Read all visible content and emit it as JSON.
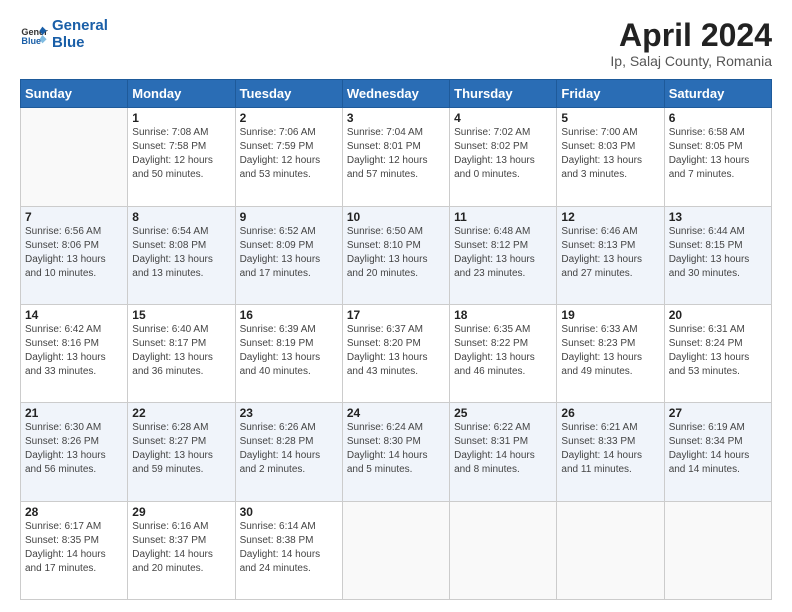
{
  "header": {
    "logo_line1": "General",
    "logo_line2": "Blue",
    "title": "April 2024",
    "subtitle": "Ip, Salaj County, Romania"
  },
  "weekdays": [
    "Sunday",
    "Monday",
    "Tuesday",
    "Wednesday",
    "Thursday",
    "Friday",
    "Saturday"
  ],
  "weeks": [
    [
      {
        "day": "",
        "info": ""
      },
      {
        "day": "1",
        "info": "Sunrise: 7:08 AM\nSunset: 7:58 PM\nDaylight: 12 hours\nand 50 minutes."
      },
      {
        "day": "2",
        "info": "Sunrise: 7:06 AM\nSunset: 7:59 PM\nDaylight: 12 hours\nand 53 minutes."
      },
      {
        "day": "3",
        "info": "Sunrise: 7:04 AM\nSunset: 8:01 PM\nDaylight: 12 hours\nand 57 minutes."
      },
      {
        "day": "4",
        "info": "Sunrise: 7:02 AM\nSunset: 8:02 PM\nDaylight: 13 hours\nand 0 minutes."
      },
      {
        "day": "5",
        "info": "Sunrise: 7:00 AM\nSunset: 8:03 PM\nDaylight: 13 hours\nand 3 minutes."
      },
      {
        "day": "6",
        "info": "Sunrise: 6:58 AM\nSunset: 8:05 PM\nDaylight: 13 hours\nand 7 minutes."
      }
    ],
    [
      {
        "day": "7",
        "info": "Sunrise: 6:56 AM\nSunset: 8:06 PM\nDaylight: 13 hours\nand 10 minutes."
      },
      {
        "day": "8",
        "info": "Sunrise: 6:54 AM\nSunset: 8:08 PM\nDaylight: 13 hours\nand 13 minutes."
      },
      {
        "day": "9",
        "info": "Sunrise: 6:52 AM\nSunset: 8:09 PM\nDaylight: 13 hours\nand 17 minutes."
      },
      {
        "day": "10",
        "info": "Sunrise: 6:50 AM\nSunset: 8:10 PM\nDaylight: 13 hours\nand 20 minutes."
      },
      {
        "day": "11",
        "info": "Sunrise: 6:48 AM\nSunset: 8:12 PM\nDaylight: 13 hours\nand 23 minutes."
      },
      {
        "day": "12",
        "info": "Sunrise: 6:46 AM\nSunset: 8:13 PM\nDaylight: 13 hours\nand 27 minutes."
      },
      {
        "day": "13",
        "info": "Sunrise: 6:44 AM\nSunset: 8:15 PM\nDaylight: 13 hours\nand 30 minutes."
      }
    ],
    [
      {
        "day": "14",
        "info": "Sunrise: 6:42 AM\nSunset: 8:16 PM\nDaylight: 13 hours\nand 33 minutes."
      },
      {
        "day": "15",
        "info": "Sunrise: 6:40 AM\nSunset: 8:17 PM\nDaylight: 13 hours\nand 36 minutes."
      },
      {
        "day": "16",
        "info": "Sunrise: 6:39 AM\nSunset: 8:19 PM\nDaylight: 13 hours\nand 40 minutes."
      },
      {
        "day": "17",
        "info": "Sunrise: 6:37 AM\nSunset: 8:20 PM\nDaylight: 13 hours\nand 43 minutes."
      },
      {
        "day": "18",
        "info": "Sunrise: 6:35 AM\nSunset: 8:22 PM\nDaylight: 13 hours\nand 46 minutes."
      },
      {
        "day": "19",
        "info": "Sunrise: 6:33 AM\nSunset: 8:23 PM\nDaylight: 13 hours\nand 49 minutes."
      },
      {
        "day": "20",
        "info": "Sunrise: 6:31 AM\nSunset: 8:24 PM\nDaylight: 13 hours\nand 53 minutes."
      }
    ],
    [
      {
        "day": "21",
        "info": "Sunrise: 6:30 AM\nSunset: 8:26 PM\nDaylight: 13 hours\nand 56 minutes."
      },
      {
        "day": "22",
        "info": "Sunrise: 6:28 AM\nSunset: 8:27 PM\nDaylight: 13 hours\nand 59 minutes."
      },
      {
        "day": "23",
        "info": "Sunrise: 6:26 AM\nSunset: 8:28 PM\nDaylight: 14 hours\nand 2 minutes."
      },
      {
        "day": "24",
        "info": "Sunrise: 6:24 AM\nSunset: 8:30 PM\nDaylight: 14 hours\nand 5 minutes."
      },
      {
        "day": "25",
        "info": "Sunrise: 6:22 AM\nSunset: 8:31 PM\nDaylight: 14 hours\nand 8 minutes."
      },
      {
        "day": "26",
        "info": "Sunrise: 6:21 AM\nSunset: 8:33 PM\nDaylight: 14 hours\nand 11 minutes."
      },
      {
        "day": "27",
        "info": "Sunrise: 6:19 AM\nSunset: 8:34 PM\nDaylight: 14 hours\nand 14 minutes."
      }
    ],
    [
      {
        "day": "28",
        "info": "Sunrise: 6:17 AM\nSunset: 8:35 PM\nDaylight: 14 hours\nand 17 minutes."
      },
      {
        "day": "29",
        "info": "Sunrise: 6:16 AM\nSunset: 8:37 PM\nDaylight: 14 hours\nand 20 minutes."
      },
      {
        "day": "30",
        "info": "Sunrise: 6:14 AM\nSunset: 8:38 PM\nDaylight: 14 hours\nand 24 minutes."
      },
      {
        "day": "",
        "info": ""
      },
      {
        "day": "",
        "info": ""
      },
      {
        "day": "",
        "info": ""
      },
      {
        "day": "",
        "info": ""
      }
    ]
  ]
}
